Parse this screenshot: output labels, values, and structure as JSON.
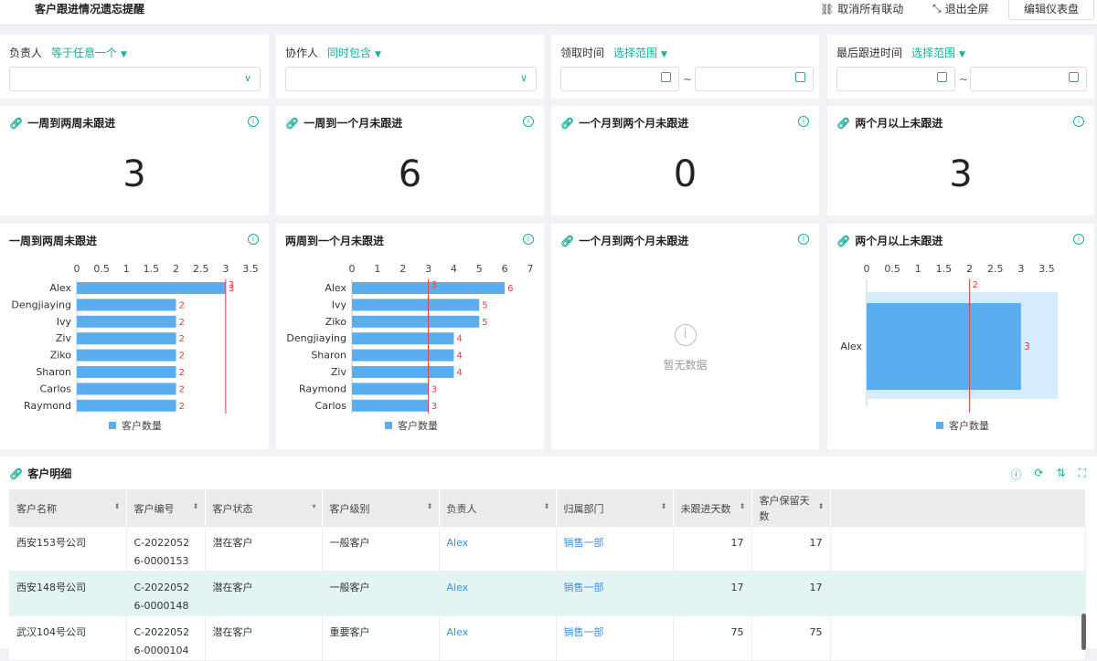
{
  "header": {
    "title": "客户跟进情况遗忘提醒",
    "unlink": "取消所有联动",
    "exit_fullscreen": "退出全屏",
    "edit": "编辑仪表盘"
  },
  "filters": [
    {
      "label": "负责人",
      "op": "等于任意一个",
      "type": "select"
    },
    {
      "label": "协作人",
      "op": "同时包含",
      "type": "select"
    },
    {
      "label": "领取时间",
      "op": "选择范围",
      "type": "range"
    },
    {
      "label": "最后跟进时间",
      "op": "选择范围",
      "type": "range"
    }
  ],
  "range_sep": "~",
  "kpis": [
    {
      "title": "一周到两周未跟进",
      "value": "3"
    },
    {
      "title": "一周到一个月未跟进",
      "value": "6"
    },
    {
      "title": "一个月到两个月未跟进",
      "value": "0"
    },
    {
      "title": "两个月以上未跟进",
      "value": "3"
    }
  ],
  "chart_data": [
    {
      "type": "bar",
      "orientation": "horizontal",
      "title": "一周到两周未跟进",
      "categories": [
        "Alex",
        "Dengjiaying",
        "Ivy",
        "Ziv",
        "Ziko",
        "Sharon",
        "Carlos",
        "Raymond"
      ],
      "series": [
        {
          "name": "客户数量",
          "values": [
            3,
            2,
            2,
            2,
            2,
            2,
            2,
            2
          ]
        }
      ],
      "xlim": [
        0,
        3.5
      ],
      "ticks": [
        "0",
        "0.5",
        "1",
        "1.5",
        "2",
        "2.5",
        "3",
        "3.5"
      ],
      "reference_line": 3,
      "color": "#5aaef0",
      "legend": "bottom"
    },
    {
      "type": "bar",
      "orientation": "horizontal",
      "title": "两周到一个月未跟进",
      "categories": [
        "Alex",
        "Ivy",
        "Ziko",
        "Dengjiaying",
        "Sharon",
        "Ziv",
        "Raymond",
        "Carlos"
      ],
      "series": [
        {
          "name": "客户数量",
          "values": [
            6,
            5,
            5,
            4,
            4,
            4,
            3,
            3
          ]
        }
      ],
      "xlim": [
        0,
        7
      ],
      "ticks": [
        "0",
        "1",
        "2",
        "3",
        "4",
        "5",
        "6",
        "7"
      ],
      "reference_line": 3,
      "color": "#5aaef0",
      "legend": "bottom"
    },
    {
      "type": "bar",
      "title": "一个月到两个月未跟进",
      "categories": [],
      "series": [],
      "empty_text": "暂无数据"
    },
    {
      "type": "bar",
      "orientation": "horizontal",
      "title": "两个月以上未跟进",
      "categories": [
        "Alex"
      ],
      "series": [
        {
          "name": "客户数量",
          "values": [
            3
          ]
        }
      ],
      "xlim": [
        0,
        3.5
      ],
      "ticks": [
        "0",
        "0.5",
        "1",
        "1.5",
        "2",
        "2.5",
        "3",
        "3.5"
      ],
      "reference_line": 2,
      "color": "#5aaef0",
      "legend": "bottom"
    }
  ],
  "table": {
    "title": "客户明细",
    "columns": [
      "客户名称",
      "客户编号",
      "客户状态",
      "客户级别",
      "负责人",
      "归属部门",
      "未跟进天数",
      "客户保留天数"
    ],
    "rows": [
      {
        "name": "西安153号公司",
        "code": "C-20220526-0000153",
        "code1": "C-2022052",
        "code2": "6-0000153",
        "status": "潜在客户",
        "level": "一般客户",
        "owner": "Alex",
        "dept": "销售一部",
        "days": "17",
        "keep": "17"
      },
      {
        "name": "西安148号公司",
        "code": "C-20220526-0000148",
        "code1": "C-2022052",
        "code2": "6-0000148",
        "status": "潜在客户",
        "level": "一般客户",
        "owner": "Alex",
        "dept": "销售一部",
        "days": "17",
        "keep": "17"
      },
      {
        "name": "武汉104号公司",
        "code": "C-20220526-0000104",
        "code1": "C-2022052",
        "code2": "6-0000104",
        "status": "潜在客户",
        "level": "重要客户",
        "owner": "Alex",
        "dept": "销售一部",
        "days": "75",
        "keep": "75"
      }
    ]
  },
  "colors": {
    "accent": "#1aae9b",
    "bar": "#5aaef0",
    "ref": "#e04040",
    "link": "#3c8ee8",
    "highlight": "#e3f5f2"
  }
}
